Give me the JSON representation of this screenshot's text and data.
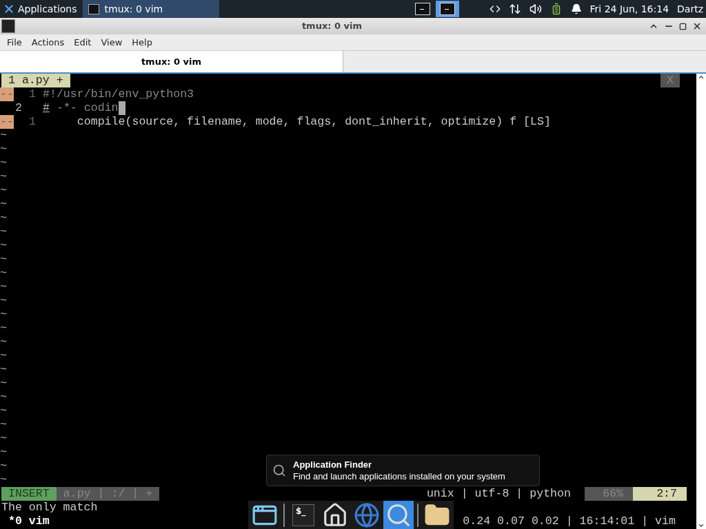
{
  "top_panel": {
    "menu_label": "Applications",
    "tasks": [
      {
        "label": "tmux: 0 vim",
        "selected": true
      }
    ],
    "workspaces": [
      {
        "selected": false
      },
      {
        "selected": true
      }
    ],
    "clock": "Fri 24 Jun, 16:14",
    "user": "Dartz"
  },
  "window": {
    "title": "tmux: 0 vim",
    "menu": [
      "File",
      "Actions",
      "Edit",
      "View",
      "Help"
    ],
    "tabs": [
      {
        "label": "tmux: 0 vim",
        "selected": true
      }
    ]
  },
  "vim": {
    "tabline": {
      "label": "1 a.py +",
      "close": "X"
    },
    "lines": [
      {
        "sign": "--",
        "number": "1",
        "current": false,
        "segments": [
          {
            "text": "#!/usr/bin/env_python3",
            "underline": false
          }
        ],
        "cursor": false
      },
      {
        "number": "2",
        "current": true,
        "segments": [
          {
            "text": "#",
            "underline": true
          },
          {
            "text": " -*- codin",
            "underline": false
          }
        ],
        "cursor": true
      },
      {
        "sign": "--",
        "number": "1",
        "current": false,
        "segments": [
          {
            "text": "     compile(source, filename, mode, flags, dont_inherit, optimize) f [LS]",
            "underline": false
          }
        ],
        "cursor": false
      }
    ],
    "tildes": [
      "~",
      "~",
      "~",
      "~",
      "~",
      "~",
      "~",
      "~",
      "~",
      "~",
      "~",
      "~",
      "~",
      "~",
      "~",
      "~",
      "~",
      "~",
      "~",
      "~",
      "~",
      "~",
      "~",
      "~",
      "~",
      "~"
    ],
    "statusline": {
      "mode": "INSERT",
      "file": "a.py | :/ | +",
      "fileinfo": "unix | utf-8 | python",
      "percent": "66%",
      "position": "2:7"
    },
    "message": "The only match"
  },
  "tmux": {
    "window": "*0 vim",
    "status": "0.24 0.07 0.02 | 16:14:01 | vim"
  },
  "tooltip": {
    "title": "Application Finder",
    "description": "Find and launch applications installed on your system"
  },
  "dock": [
    {
      "kind": "desktop",
      "selected": false
    },
    {
      "kind": "separator"
    },
    {
      "kind": "terminal",
      "label": "$_",
      "selected": false
    },
    {
      "kind": "home",
      "selected": false
    },
    {
      "kind": "globe",
      "selected": false
    },
    {
      "kind": "search",
      "selected": true
    },
    {
      "kind": "separator"
    },
    {
      "kind": "folder",
      "selected": false
    }
  ]
}
